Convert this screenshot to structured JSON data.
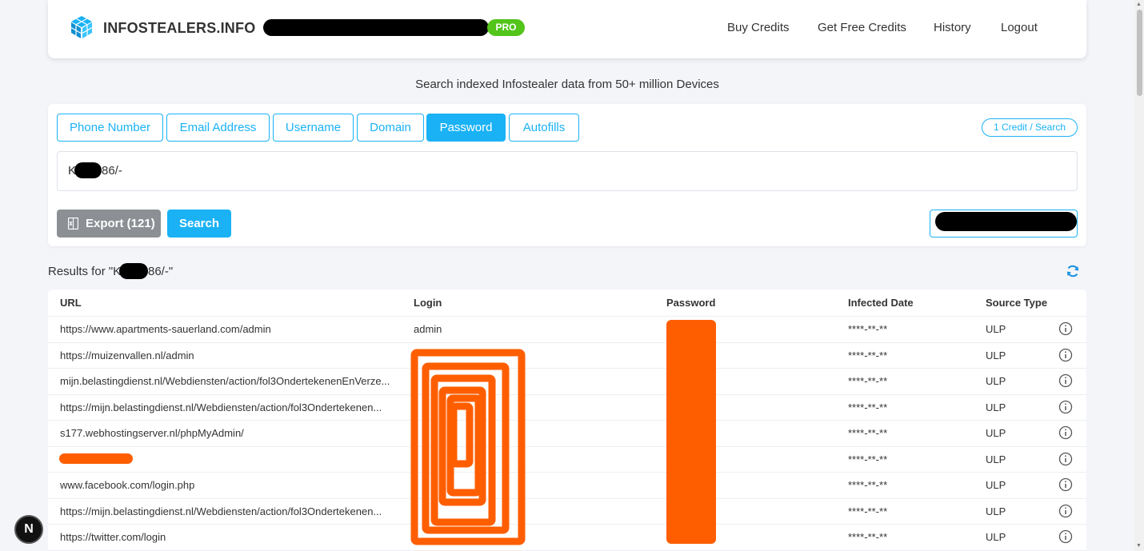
{
  "header": {
    "brand": "INFOSTEALERS.INFO",
    "badge": "PRO",
    "nav": [
      "Buy Credits",
      "Get Free Credits",
      "History",
      "Logout"
    ]
  },
  "subtitle": "Search indexed Infostealer data from 50+ million Devices",
  "search": {
    "tabs": [
      "Phone Number",
      "Email Address",
      "Username",
      "Domain",
      "Password",
      "Autofills"
    ],
    "active_tab": "Password",
    "credit_badge": "1 Credit / Search",
    "query_prefix": "K",
    "query_suffix": "86/-",
    "export_label": "Export (121)",
    "search_label": "Search"
  },
  "results": {
    "title_prefix": "Results for \"K",
    "title_suffix": "86/-\"",
    "columns": [
      "URL",
      "Login",
      "Password",
      "Infected Date",
      "Source Type"
    ],
    "rows": [
      {
        "url": "https://www.apartments-sauerland.com/admin",
        "login": "admin",
        "date": "****-**-**",
        "source": "ULP"
      },
      {
        "url": "https://muizenvallen.nl/admin",
        "login": "",
        "date": "****-**-**",
        "source": "ULP"
      },
      {
        "url": "mijn.belastingdienst.nl/Webdiensten/action/fol3OndertekenenEnVerze...",
        "login": "",
        "date": "****-**-**",
        "source": "ULP"
      },
      {
        "url": "https://mijn.belastingdienst.nl/Webdiensten/action/fol3Ondertekenen...",
        "login": "",
        "date": "****-**-**",
        "source": "ULP"
      },
      {
        "url": "s177.webhostingserver.nl/phpMyAdmin/",
        "login": "",
        "date": "****-**-**",
        "source": "ULP"
      },
      {
        "url": "",
        "login": "",
        "date": "****-**-**",
        "source": "ULP"
      },
      {
        "url": "www.facebook.com/login.php",
        "login": "",
        "date": "****-**-**",
        "source": "ULP"
      },
      {
        "url": "https://mijn.belastingdienst.nl/Webdiensten/action/fol3Ondertekenen...",
        "login": "",
        "date": "****-**-**",
        "source": "ULP"
      },
      {
        "url": "https://twitter.com/login",
        "login": "",
        "date": "****-**-**",
        "source": "ULP"
      }
    ]
  },
  "misc": {
    "next_badge": "N",
    "accent_color": "#1ab2f5",
    "pro_color": "#52c41a",
    "redaction_color": "#ff5e00"
  }
}
